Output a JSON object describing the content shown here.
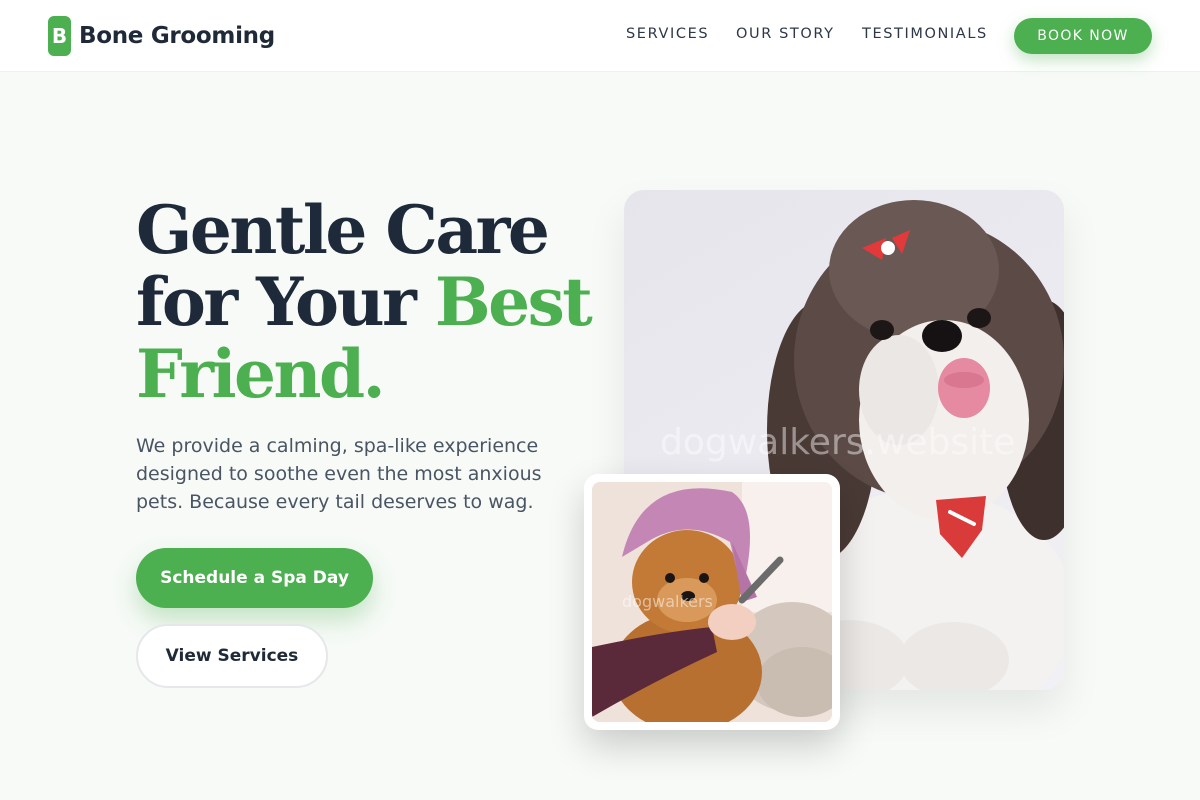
{
  "header": {
    "logo_letter": "B",
    "brand_name": "Bone Grooming",
    "nav": {
      "services": "SERVICES",
      "our_story": "OUR STORY",
      "testimonials": "TESTIMONIALS"
    },
    "book_now": "BOOK NOW"
  },
  "hero": {
    "headline_line1": "Gentle Care",
    "headline_line2_start": "for Your ",
    "headline_line2_accent": "Best",
    "headline_line3": "Friend.",
    "subtext": "We provide a calming, spa-like experience designed to soothe even the most anxious pets. Because every tail deserves to wag.",
    "primary_cta": "Schedule a Spa Day",
    "secondary_cta": "View Services",
    "main_photo_watermark": "dogwalkers.website",
    "small_photo_watermark": "dogwalkers"
  },
  "colors": {
    "brand_green": "#4caf50",
    "heading_navy": "#1e2a3a",
    "page_background": "#f7faf7"
  },
  "icons": {
    "logo": "letter-b-badge"
  }
}
